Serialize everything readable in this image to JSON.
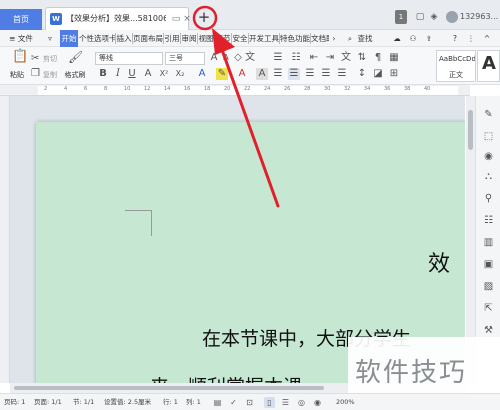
{
  "titlebar": {
    "home_tab": "首页",
    "doc_tab_icon": "W",
    "doc_tab_title": "【效果分析】效果...5810065*",
    "new_tab": "+",
    "badge": "1",
    "username": "132963..."
  },
  "menubar": {
    "file": "≡ 文件",
    "items": [
      "开始",
      "个性选项卡",
      "插入",
      "页面布局",
      "引用",
      "审阅",
      "视图",
      "章节",
      "安全",
      "开发工具",
      "特色功能",
      "文档助"
    ],
    "search": "查找"
  },
  "ribbon": {
    "paste": "粘贴",
    "cut": "剪切",
    "copy": "复制",
    "format_painter": "格式刷",
    "font_name": "等线",
    "font_size": "三号",
    "style_normal_preview": "AaBbCcDd",
    "style_normal_label": "正文",
    "style_heading_preview": "A"
  },
  "document": {
    "title_fragment": "效",
    "line1": "在本节课中，大部分学生",
    "line2": "来，顺利掌握本课"
  },
  "statusbar": {
    "page": "页码: 1",
    "pages": "页面: 1/1",
    "section": "节: 1/1",
    "settings": "设置值: 2.5厘米",
    "row": "行: 1",
    "col": "列: 1",
    "zoom": "200%"
  },
  "watermark": "软件技巧",
  "colors": {
    "accent": "#4f7de4",
    "page_background": "#c6e8d3",
    "annotation": "#e0212b"
  }
}
